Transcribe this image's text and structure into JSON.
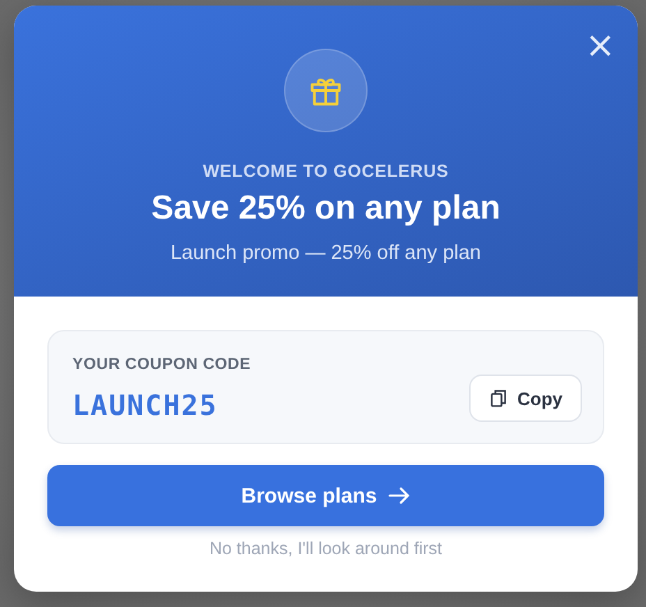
{
  "modal": {
    "close_label": "×",
    "eyebrow": "WELCOME TO GOCELERUS",
    "title": "Save 25% on any plan",
    "subtitle": "Launch promo — 25% off any plan",
    "coupon": {
      "label": "YOUR COUPON CODE",
      "code": "LAUNCH25",
      "copy_button": "Copy"
    },
    "primary_button": "Browse plans",
    "dismiss_link": "No thanks, I'll look around first"
  }
}
